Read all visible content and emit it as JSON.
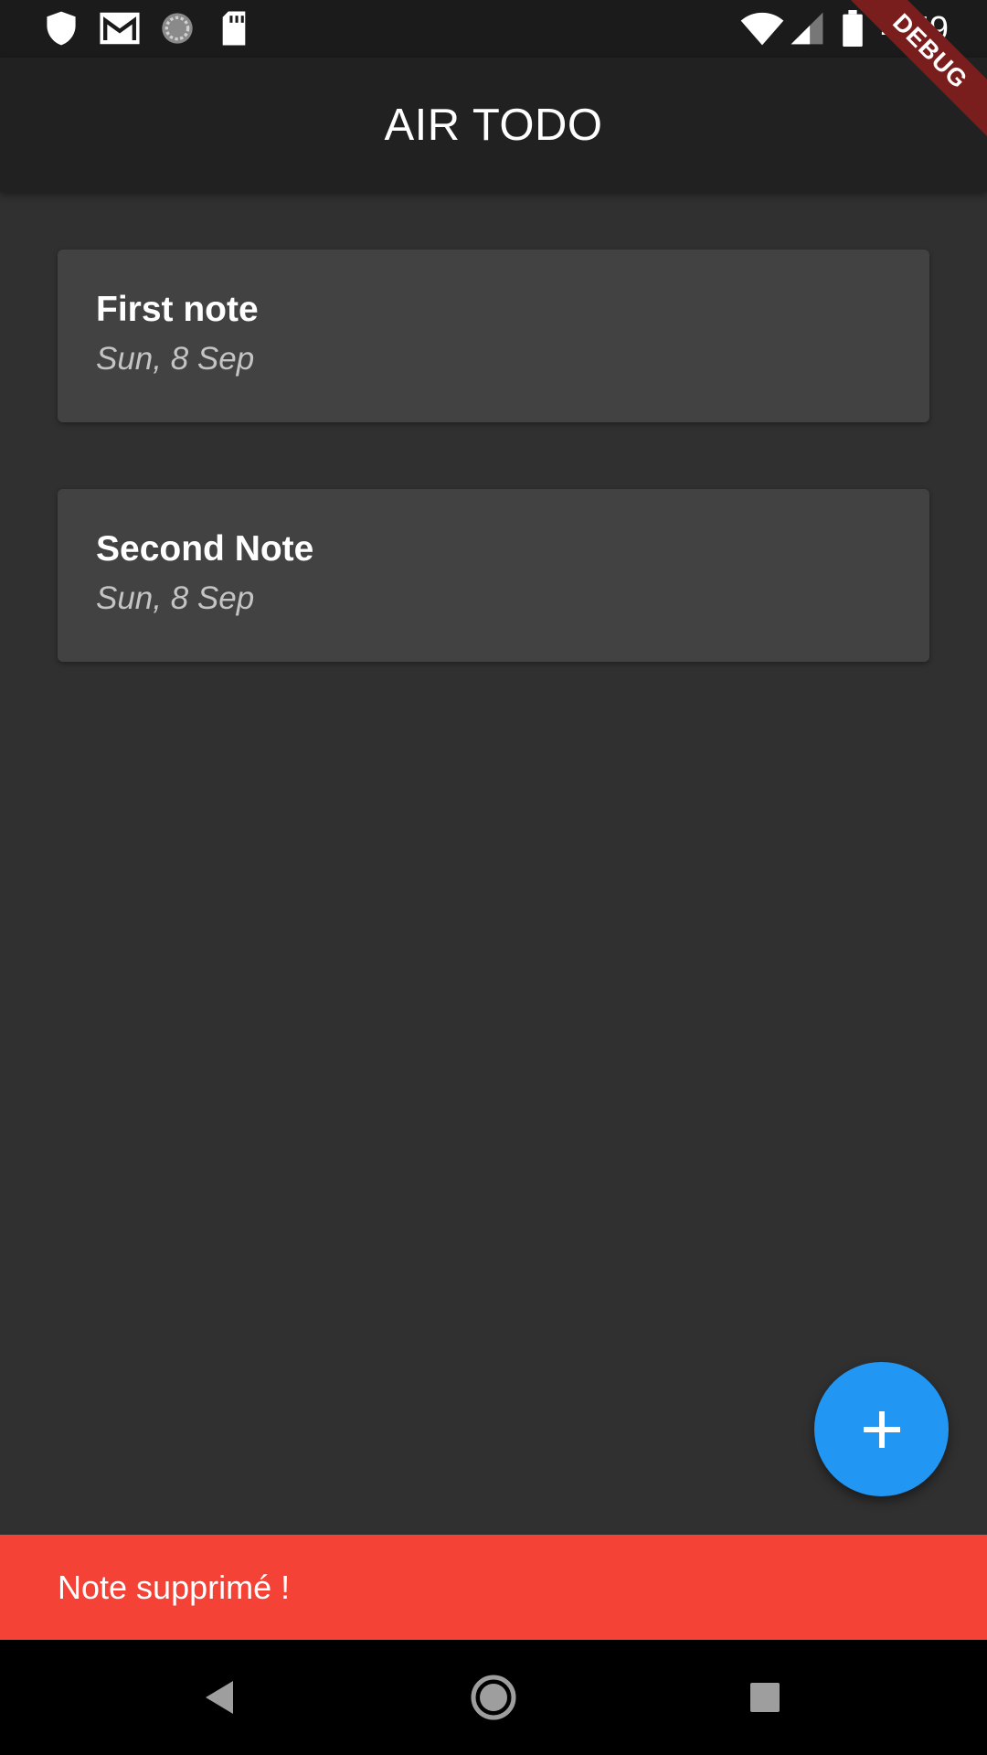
{
  "status_bar": {
    "time": "4:59",
    "left_icons": [
      "shield-icon",
      "gmail-icon",
      "sync-circle-icon",
      "sd-card-icon"
    ],
    "right_icons": [
      "wifi-icon",
      "signal-icon",
      "battery-icon"
    ]
  },
  "debug_banner": {
    "label": "DEBUG"
  },
  "app_bar": {
    "title": "AIR TODO"
  },
  "notes": [
    {
      "title": "First note",
      "date": "Sun, 8 Sep"
    },
    {
      "title": "Second Note",
      "date": "Sun, 8 Sep"
    }
  ],
  "fab": {
    "icon": "plus-icon",
    "color": "#2196f3"
  },
  "snackbar": {
    "message": "Note supprimé !",
    "color": "#f44336"
  },
  "nav_bar": {
    "buttons": [
      "back-icon",
      "home-icon",
      "recents-icon"
    ]
  }
}
